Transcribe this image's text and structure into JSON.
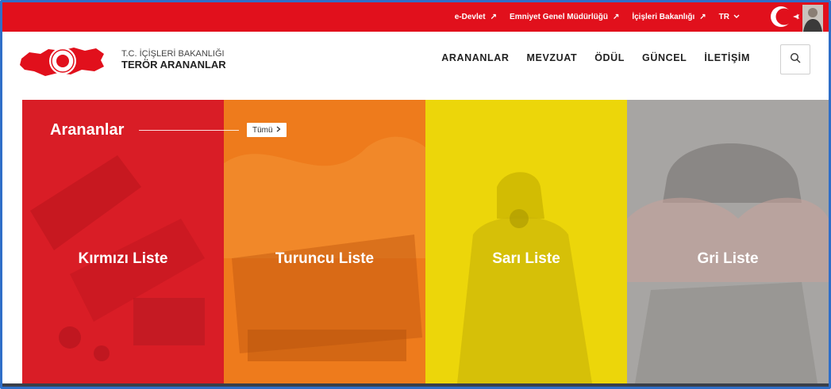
{
  "topbar": {
    "links": [
      "e-Devlet",
      "Emniyet Genel Müdürlüğü",
      "İçişleri Bakanlığı"
    ],
    "language": "TR"
  },
  "header": {
    "brand_top": "T.C. İÇİŞLERİ BAKANLIĞI",
    "brand_main": "TERÖR ARANANLAR",
    "nav": [
      "ARANANLAR",
      "MEVZUAT",
      "ÖDÜL",
      "GÜNCEL",
      "İLETİŞİM"
    ]
  },
  "section": {
    "title": "Arananlar",
    "all_label": "Tümü"
  },
  "panels": [
    {
      "label": "Kırmızı Liste",
      "color": "#d91d26"
    },
    {
      "label": "Turuncu Liste",
      "color": "#ee7b1c"
    },
    {
      "label": "Sarı Liste",
      "color": "#ecd60a"
    },
    {
      "label": "Gri Liste",
      "color": "#a7a5a3"
    }
  ],
  "icons": [
    "external-link-icon",
    "chevron-down-icon",
    "search-icon",
    "chevron-right-icon",
    "ministry-logo",
    "turkish-flag"
  ],
  "colors": {
    "brand_red": "#e1101c",
    "frame_blue": "#2f6ec8"
  }
}
